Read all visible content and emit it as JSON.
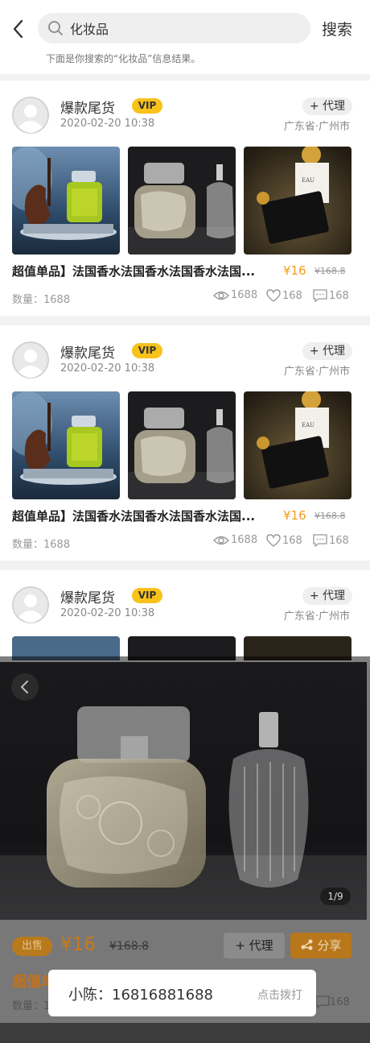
{
  "search": {
    "value": "化妆品",
    "button_label": "搜索",
    "hint": "下面是你搜索的“化妆品”信息结果。"
  },
  "cards": [
    {
      "seller": "爆款尾货",
      "badge": "VIP",
      "date": "2020-02-20 10:38",
      "agent_label": "+ 代理",
      "location": "广东省·广州市",
      "title": "超值单品】法国香水法国香水法国香水法国...",
      "price": "¥16",
      "original_price": "¥168.8",
      "quantity": "数量：1688",
      "views": "1688",
      "likes": "168",
      "comments": "168"
    },
    {
      "seller": "爆款尾货",
      "badge": "VIP",
      "date": "2020-02-20 10:38",
      "agent_label": "+ 代理",
      "location": "广东省·广州市",
      "title": "超值单品】法国香水法国香水法国香水法国...",
      "price": "¥16",
      "original_price": "¥168.8",
      "quantity": "数量：1688",
      "views": "1688",
      "likes": "168",
      "comments": "168"
    },
    {
      "seller": "爆款尾货",
      "badge": "VIP",
      "date": "2020-02-20 10:38",
      "agent_label": "+ 代理",
      "location": "广东省·广州市"
    }
  ],
  "viewer": {
    "counter": "1/9"
  },
  "detail_bar": {
    "sell_badge": "出售",
    "price": "¥16",
    "original_price": "¥168.8",
    "agent_label": "+ 代理",
    "share_label": "分享",
    "title": "超值单",
    "title_ellipsis": "...",
    "quantity": "数量：1",
    "comments": "168"
  },
  "toast": {
    "contact": "小陈：16816881688",
    "dial_label": "点击拨打"
  },
  "colors": {
    "accent": "#f29b1c",
    "vip": "#f8c21b"
  },
  "icons": {
    "back": "chevron-left-icon",
    "search": "search-icon",
    "views": "eye-icon",
    "likes": "heart-icon",
    "comments": "comment-icon",
    "share": "share-icon"
  }
}
